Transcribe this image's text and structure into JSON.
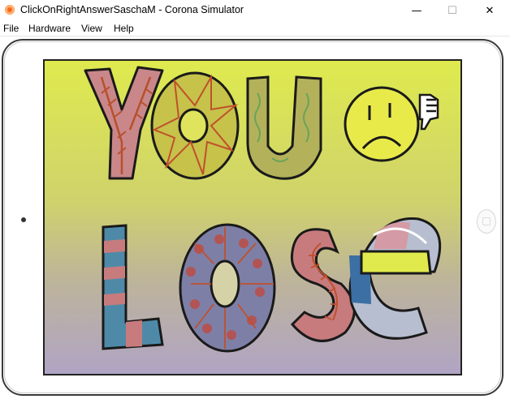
{
  "window": {
    "title": "ClickOnRightAnswerSaschaM - Corona Simulator",
    "min_glyph": "—",
    "max_glyph": "☐",
    "close_glyph": "✕"
  },
  "menu": {
    "file": "File",
    "hardware": "Hardware",
    "view": "View",
    "help": "Help"
  },
  "screen": {
    "message_line1": "YOU",
    "message_line2": "LOSE",
    "icons": [
      "sad-face-icon",
      "thumbs-down-icon"
    ],
    "colors": {
      "top_bg": "#dfea4e",
      "bottom_bg": "#b0a4c4",
      "letter_y": "#c9878a",
      "letter_o1": "#c6c24a",
      "letter_u": "#b3b25a",
      "letter_l": "#4e8aa8",
      "letter_o2": "#7e7fa6",
      "letter_s": "#c77b7d",
      "letter_e": "#b7bed0"
    }
  }
}
